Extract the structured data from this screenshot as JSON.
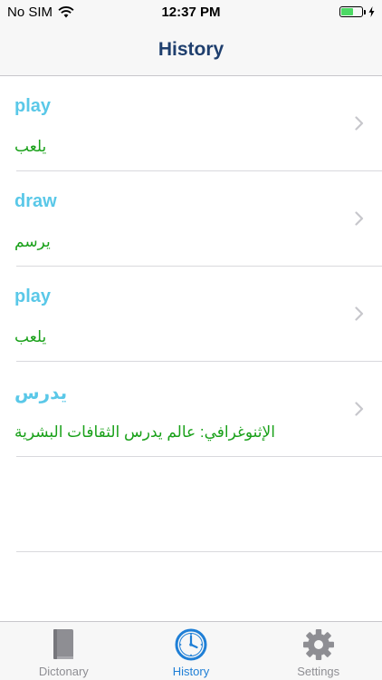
{
  "status_bar": {
    "carrier": "No SIM",
    "time": "12:37 PM",
    "battery_level": 0.6
  },
  "nav": {
    "title": "History"
  },
  "history": [
    {
      "word": "play",
      "meaning": "يلعب"
    },
    {
      "word": "draw",
      "meaning": "يرسم"
    },
    {
      "word": "play",
      "meaning": "يلعب"
    },
    {
      "word": "يدرس",
      "meaning": "الإثنوغرافي: عالم يدرس الثقافات البشرية"
    }
  ],
  "tabs": [
    {
      "label": "Dictonary",
      "icon": "book-icon",
      "active": false
    },
    {
      "label": "History",
      "icon": "clock-icon",
      "active": true
    },
    {
      "label": "Settings",
      "icon": "gear-icon",
      "active": false
    }
  ],
  "colors": {
    "word": "#5ac8e8",
    "meaning": "#1aa11a",
    "nav_title": "#1f3f6e",
    "tab_active": "#1f7fd6",
    "tab_inactive": "#8e8e93",
    "battery": "#4cd964"
  }
}
